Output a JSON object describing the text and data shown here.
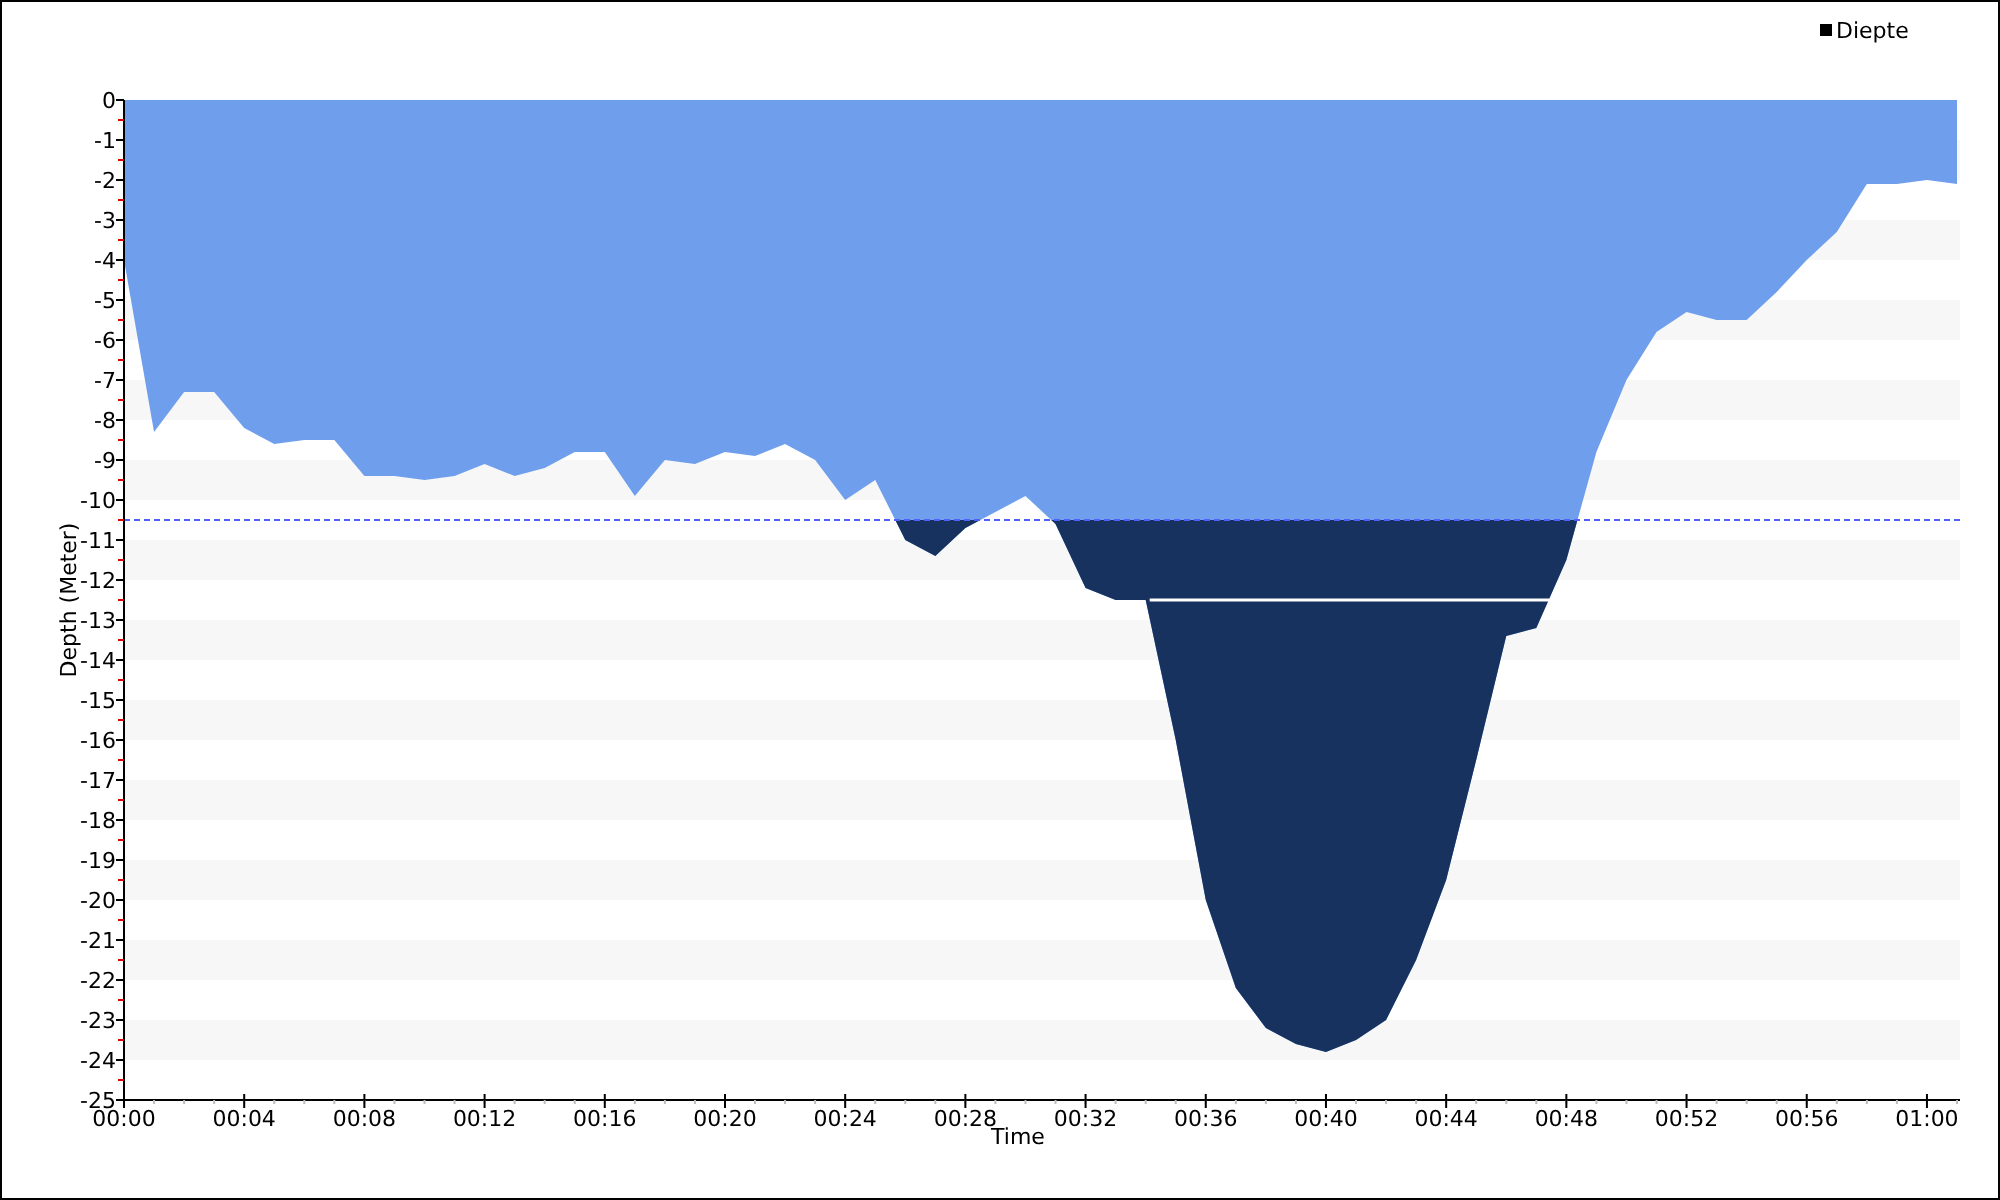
{
  "chart": {
    "chart_data": {
      "type": "area",
      "xlabel": "Time",
      "ylabel": "Depth (Meter)",
      "x": [
        0,
        1,
        2,
        3,
        4,
        5,
        6,
        7,
        8,
        9,
        10,
        11,
        12,
        13,
        14,
        15,
        16,
        17,
        18,
        19,
        20,
        21,
        22,
        23,
        24,
        25,
        26,
        27,
        28,
        29,
        30,
        31,
        32,
        33,
        34,
        35,
        36,
        37,
        38,
        39,
        40,
        41,
        42,
        43,
        44,
        45,
        46,
        47,
        48,
        49,
        50,
        51,
        52,
        53,
        54,
        55,
        56,
        57,
        58,
        59,
        60,
        61
      ],
      "series": [
        {
          "name": "Diepte",
          "color": "#6f9fec",
          "values": [
            -4,
            -8.3,
            -7.3,
            -7.3,
            -8.2,
            -8.6,
            -8.5,
            -8.5,
            -9.4,
            -9.4,
            -9.5,
            -9.4,
            -9.1,
            -9.4,
            -9.2,
            -8.8,
            -8.8,
            -9.9,
            -9.0,
            -9.1,
            -8.8,
            -8.9,
            -8.6,
            -9.0,
            -10.0,
            -9.5,
            -11.0,
            -11.4,
            -10.7,
            -10.3,
            -9.9,
            -10.6,
            -12.2,
            -12.5,
            -12.5,
            -16,
            -20,
            -22.2,
            -23.2,
            -23.6,
            -23.8,
            -23.5,
            -23,
            -21.5,
            -19.5,
            -16.5,
            -13.4,
            -13.2,
            -11.5,
            -8.8,
            -7,
            -5.8,
            -5.3,
            -5.5,
            -5.5,
            -4.8,
            -4.0,
            -3.3,
            -2.1,
            -2.1,
            -2.0,
            -2.1
          ]
        }
      ],
      "xlim": [
        0,
        61.1
      ],
      "ylim": [
        -25,
        0
      ],
      "xticks": [
        {
          "value": 0,
          "label": "00:00"
        },
        {
          "value": 4,
          "label": "00:04"
        },
        {
          "value": 8,
          "label": "00:08"
        },
        {
          "value": 12,
          "label": "00:12"
        },
        {
          "value": 16,
          "label": "00:16"
        },
        {
          "value": 20,
          "label": "00:20"
        },
        {
          "value": 24,
          "label": "00:24"
        },
        {
          "value": 28,
          "label": "00:28"
        },
        {
          "value": 32,
          "label": "00:32"
        },
        {
          "value": 36,
          "label": "00:36"
        },
        {
          "value": 40,
          "label": "00:40"
        },
        {
          "value": 44,
          "label": "00:44"
        },
        {
          "value": 48,
          "label": "00:48"
        },
        {
          "value": 52,
          "label": "00:52"
        },
        {
          "value": 56,
          "label": "00:56"
        },
        {
          "value": 60,
          "label": "01:00"
        }
      ],
      "yticks": [
        0,
        -1,
        -2,
        -3,
        -4,
        -5,
        -6,
        -7,
        -8,
        -9,
        -10,
        -11,
        -12,
        -13,
        -14,
        -15,
        -16,
        -17,
        -18,
        -19,
        -20,
        -21,
        -22,
        -23,
        -24,
        -25
      ],
      "ref_lines": [
        {
          "axis": "y",
          "value": -10.5
        }
      ]
    }
  }
}
